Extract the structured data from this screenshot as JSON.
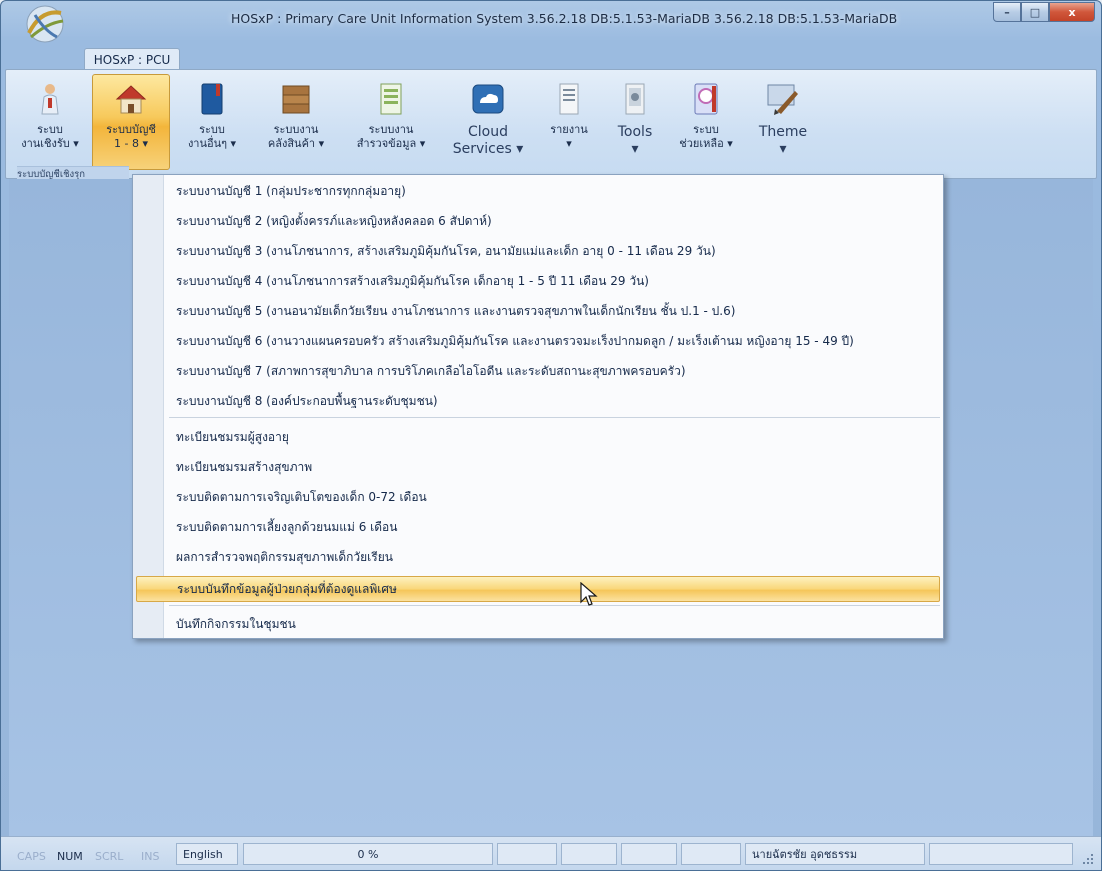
{
  "window": {
    "title": "HOSxP : Primary Care Unit Information System 3.56.2.18 DB:5.1.53-MariaDB 3.56.2.18 DB:5.1.53-MariaDB",
    "controls": {
      "minimize": "–",
      "maximize": "□",
      "close": "x"
    }
  },
  "ribbon": {
    "tab_label": "HOSxP : PCU",
    "group_caption": "ระบบบัญชีเชิงรุก",
    "buttons": [
      {
        "line1": "ระบบ",
        "line2": "งานเชิงรับ ▾",
        "icon": "person-icon"
      },
      {
        "line1": "ระบบบัญชี",
        "line2": "1 - 8 ▾",
        "icon": "house-icon",
        "active": true
      },
      {
        "line1": "ระบบ",
        "line2": "งานอื่นๆ ▾",
        "icon": "book-icon"
      },
      {
        "line1": "ระบบงาน",
        "line2": "คลังสินค้า ▾",
        "icon": "warehouse-icon"
      },
      {
        "line1": "ระบบงาน",
        "line2": "สำรวจข้อมูล ▾",
        "icon": "survey-icon"
      },
      {
        "line1": "Cloud",
        "line2": "Services ▾",
        "icon": "cloud-icon"
      },
      {
        "line1": "รายงาน",
        "line2": "▾",
        "icon": "report-icon"
      },
      {
        "line1": "Tools",
        "line2": "▾",
        "icon": "tools-icon"
      },
      {
        "line1": "ระบบ",
        "line2": "ช่วยเหลือ ▾",
        "icon": "help-book-icon"
      },
      {
        "line1": "Theme",
        "line2": "▾",
        "icon": "brush-icon"
      }
    ]
  },
  "menu": {
    "items": [
      "ระบบงานบัญชี 1 (กลุ่มประชากรทุกกลุ่มอายุ)",
      "ระบบงานบัญชี 2 (หญิงตั้งครรภ์และหญิงหลังคลอด 6 สัปดาห์)",
      "ระบบงานบัญชี 3 (งานโภชนาการ, สร้างเสริมภูมิคุ้มกันโรค, อนามัยแม่และเด็ก อายุ 0 - 11 เดือน 29 วัน)",
      "ระบบงานบัญชี 4 (งานโภชนาการสร้างเสริมภูมิคุ้มกันโรค เด็กอายุ 1 - 5 ปี 11 เดือน 29 วัน)",
      "ระบบงานบัญชี 5 (งานอนามัยเด็กวัยเรียน งานโภชนาการ และงานตรวจสุขภาพในเด็กนักเรียน ชั้น ป.1 - ป.6)",
      "ระบบงานบัญชี 6 (งานวางแผนครอบครัว สร้างเสริมภูมิคุ้มกันโรค และงานตรวจมะเร็งปากมดลูก / มะเร็งเต้านม หญิงอายุ 15 - 49 ปี)",
      "ระบบงานบัญชี 7 (สภาพการสุขาภิบาล การบริโภคเกลือไอโอดีน และระดับสถานะสุขภาพครอบครัว)",
      "ระบบงานบัญชี 8 (องค์ประกอบพื้นฐานระดับชุมชน)",
      "ทะเบียนชมรมผู้สูงอายุ",
      "ทะเบียนชมรมสร้างสุขภาพ",
      "ระบบติดตามการเจริญเติบโตของเด็ก 0-72 เดือน",
      "ระบบติดตามการเลี้ยงลูกด้วยนมแม่ 6 เดือน",
      "ผลการสำรวจพฤติกรรมสุขภาพเด็กวัยเรียน",
      "ระบบบันทึกข้อมูลผู้ป่วยกลุ่มที่ต้องดูแลพิเศษ",
      "บันทึกกิจกรรมในชุมชน"
    ],
    "highlighted_index": 13
  },
  "statusbar": {
    "caps": "CAPS",
    "num": "NUM",
    "scrl": "SCRL",
    "ins": "INS",
    "language": "English",
    "progress": "0 %",
    "progress_value": 0,
    "user": "นายฉัตรชัย อุดชธรรม"
  }
}
